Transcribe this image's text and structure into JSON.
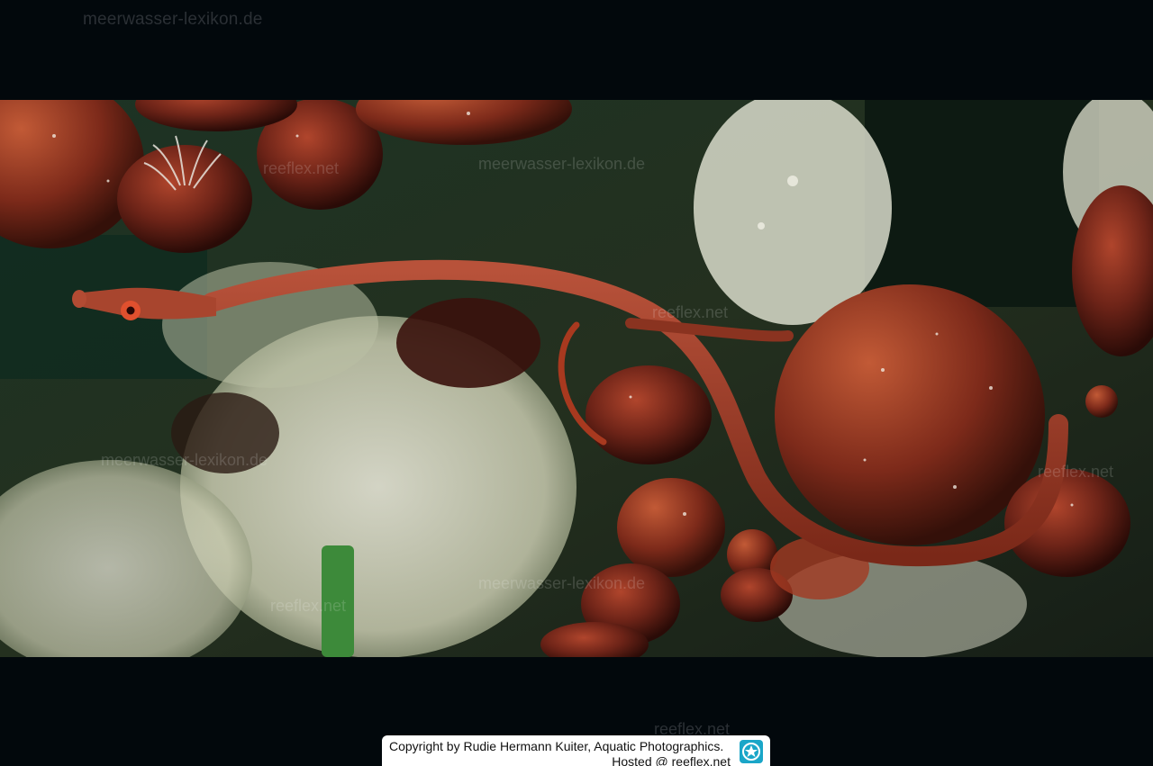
{
  "header": {
    "site_watermark": "meerwasser-lexikon.de"
  },
  "photo": {
    "watermarks": [
      "reeflex.net",
      "meerwasser-lexikon.de",
      "reeflex.net",
      "meerwasser-lexikon.de",
      "reeflex.net",
      "reeflex.net",
      "meerwasser-lexikon.de"
    ]
  },
  "footer": {
    "watermark": "reeflex.net",
    "copyright_line1": "Copyright by Rudie Hermann Kuiter, Aquatic Photographics.",
    "copyright_line2": "Hosted @ reeflex.net",
    "logo_icon": "reeflex-star-icon"
  },
  "colors": {
    "background": "#02080c",
    "fish": "#9a3b22",
    "algae": "#7a2a1c",
    "logo": "#1aa6c8"
  }
}
